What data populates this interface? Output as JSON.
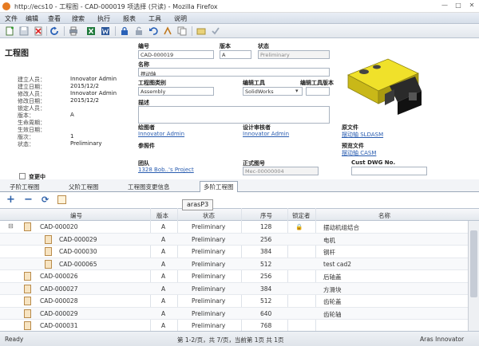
{
  "window": {
    "title": "http://ecs10 - 工程图 - CAD-000019 项选择 (只读) - Mozilla Firefox",
    "minimize": "—",
    "maximize": "□",
    "close": "✕"
  },
  "menu": [
    "文件",
    "编辑",
    "查看",
    "搜索",
    "执行",
    "报表",
    "工具",
    "说明"
  ],
  "toolbar_icons": [
    "new-icon",
    "save-icon",
    "delete-icon",
    "refresh-icon",
    "print-icon",
    "excel-icon",
    "word-icon",
    "lock-icon",
    "unlock-icon",
    "undo-icon",
    "promote-icon",
    "copy-icon",
    "done-icon",
    "check-icon"
  ],
  "form": {
    "heading": "工程图",
    "meta": [
      {
        "label": "建立人员：",
        "value": "Innovator Admin"
      },
      {
        "label": "建立日期：",
        "value": "2015/12/2"
      },
      {
        "label": "修改人员：",
        "value": "Innovator Admin"
      },
      {
        "label": "修改日期：",
        "value": "2015/12/2"
      },
      {
        "label": "锁定人员：",
        "value": ""
      },
      {
        "label": "版本：",
        "value": "A"
      },
      {
        "label": "生命周期：",
        "value": ""
      },
      {
        "label": "生效日期：",
        "value": ""
      },
      {
        "label": "版次：",
        "value": "1"
      },
      {
        "label": "状态：",
        "value": "Preliminary"
      }
    ],
    "number_label": "编号",
    "number_value": "CAD-000019",
    "rev_label": "版本",
    "rev_value": "A",
    "state_label": "状态",
    "state_value": "Preliminary",
    "name_label": "名称",
    "name_value": "摆动轴",
    "class_label": "工程图类别",
    "class_value": "Assembly",
    "tool_label": "编辑工具",
    "tool_value": "SolidWorks",
    "tool_ver_label": "编辑工具版本",
    "desc_label": "描述",
    "desc_value": "",
    "designer_label": "绘图者",
    "designer_value": "Innovator Admin",
    "checker_label": "设计审核者",
    "checker_value": "Innovator Admin",
    "native_label": "原文件",
    "native_value": "摆动轴 SLDASM",
    "ref_label": "参照件",
    "viewable_label": "预览文件",
    "viewable_value": "摆动轴 CASM",
    "team_label": "团队",
    "team_value": "1328 Bob..'s Project",
    "formal_label": "正式图号",
    "formal_value": "Mec-00000004",
    "dwg_label": "Cust DWG No.",
    "dwg_value": "",
    "bottom_check": "变更中"
  },
  "tabs": [
    "子阶工程图",
    "父阶工程图",
    "工程图变更信息",
    "多阶工程图"
  ],
  "tooltip": "arasP3",
  "grid_toolbar": {
    "add": "+",
    "remove": "−",
    "refresh": "⟳"
  },
  "grid": {
    "headers": [
      "编号",
      "版本",
      "状态",
      "序号",
      "锁定者",
      "名称"
    ],
    "rows": [
      {
        "number": "CAD-000020",
        "rev": "A",
        "state": "Preliminary",
        "seq": "128",
        "lock": "🔒",
        "name": "摆动机组结合"
      },
      {
        "number": "CAD-000029",
        "rev": "A",
        "state": "Preliminary",
        "seq": "256",
        "lock": "",
        "name": "电机"
      },
      {
        "number": "CAD-000030",
        "rev": "A",
        "state": "Preliminary",
        "seq": "384",
        "lock": "",
        "name": "钢杆"
      },
      {
        "number": "CAD-000065",
        "rev": "A",
        "state": "Preliminary",
        "seq": "512",
        "lock": "",
        "name": "test cad2"
      },
      {
        "number": "CAD-000026",
        "rev": "A",
        "state": "Preliminary",
        "seq": "256",
        "lock": "",
        "name": "后轴盖"
      },
      {
        "number": "CAD-000027",
        "rev": "A",
        "state": "Preliminary",
        "seq": "384",
        "lock": "",
        "name": "方滑块"
      },
      {
        "number": "CAD-000028",
        "rev": "A",
        "state": "Preliminary",
        "seq": "512",
        "lock": "",
        "name": "齿轮盖"
      },
      {
        "number": "CAD-000029",
        "rev": "A",
        "state": "Preliminary",
        "seq": "640",
        "lock": "",
        "name": "齿轮轴"
      },
      {
        "number": "CAD-000031",
        "rev": "A",
        "state": "Preliminary",
        "seq": "768",
        "lock": "",
        "name": ""
      }
    ]
  },
  "status": {
    "left": "Ready",
    "center": "第 1-2/页，共 7/页，当前第 1页 共 1页",
    "right": "Aras Innovator"
  }
}
